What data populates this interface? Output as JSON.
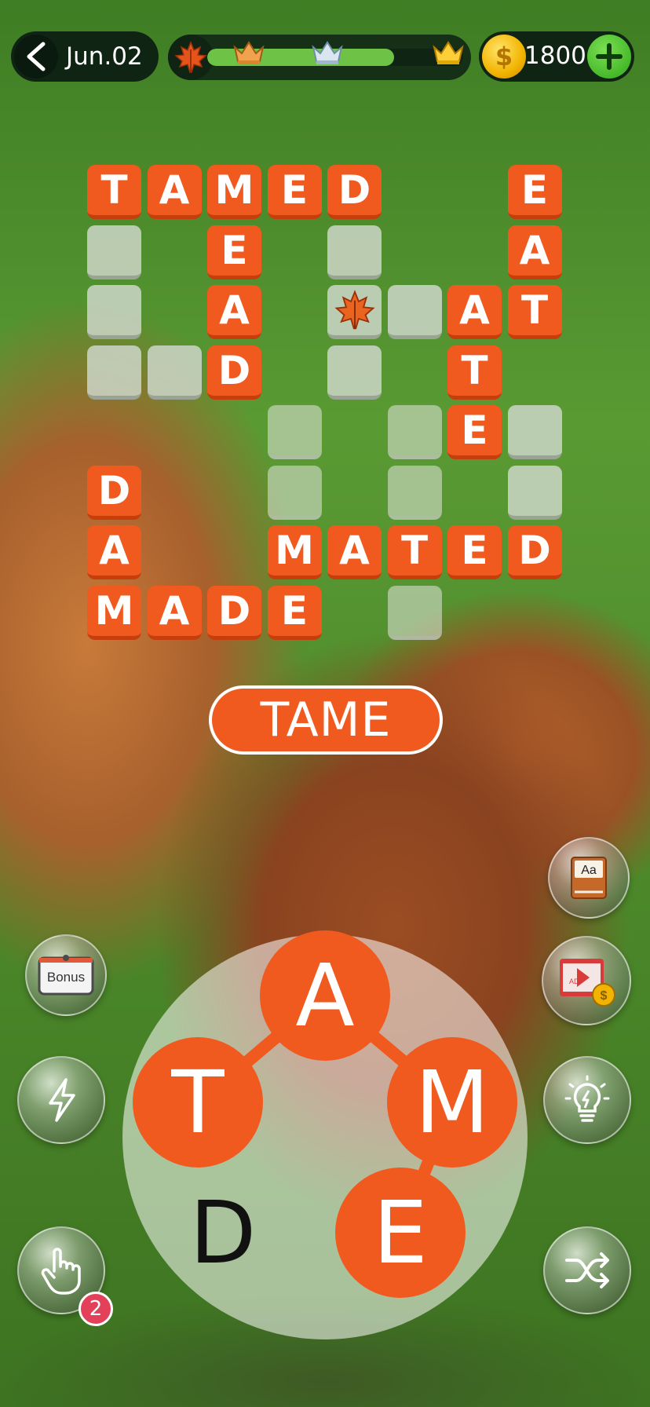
{
  "header": {
    "date": "Jun.02",
    "coins": "1800",
    "level_progress": 0.73
  },
  "grid": {
    "filled_cells": [
      {
        "col": 0,
        "row": 0,
        "letter": "T"
      },
      {
        "col": 1,
        "row": 0,
        "letter": "A"
      },
      {
        "col": 2,
        "row": 0,
        "letter": "M"
      },
      {
        "col": 3,
        "row": 0,
        "letter": "E"
      },
      {
        "col": 4,
        "row": 0,
        "letter": "D"
      },
      {
        "col": 7,
        "row": 0,
        "letter": "E"
      },
      {
        "col": 2,
        "row": 1,
        "letter": "E"
      },
      {
        "col": 7,
        "row": 1,
        "letter": "A"
      },
      {
        "col": 2,
        "row": 2,
        "letter": "A"
      },
      {
        "col": 6,
        "row": 2,
        "letter": "A"
      },
      {
        "col": 7,
        "row": 2,
        "letter": "T"
      },
      {
        "col": 2,
        "row": 3,
        "letter": "D"
      },
      {
        "col": 6,
        "row": 3,
        "letter": "T"
      },
      {
        "col": 6,
        "row": 4,
        "letter": "E"
      },
      {
        "col": 0,
        "row": 5,
        "letter": "D"
      },
      {
        "col": 0,
        "row": 6,
        "letter": "A"
      },
      {
        "col": 3,
        "row": 6,
        "letter": "M"
      },
      {
        "col": 4,
        "row": 6,
        "letter": "A"
      },
      {
        "col": 5,
        "row": 6,
        "letter": "T"
      },
      {
        "col": 6,
        "row": 6,
        "letter": "E"
      },
      {
        "col": 7,
        "row": 6,
        "letter": "D"
      },
      {
        "col": 0,
        "row": 7,
        "letter": "M"
      },
      {
        "col": 1,
        "row": 7,
        "letter": "A"
      },
      {
        "col": 2,
        "row": 7,
        "letter": "D"
      },
      {
        "col": 3,
        "row": 7,
        "letter": "E"
      }
    ],
    "empty_cells": [
      {
        "col": 0,
        "row": 1
      },
      {
        "col": 4,
        "row": 1
      },
      {
        "col": 0,
        "row": 2
      },
      {
        "col": 5,
        "row": 2
      },
      {
        "col": 0,
        "row": 3
      },
      {
        "col": 1,
        "row": 3
      },
      {
        "col": 4,
        "row": 3
      },
      {
        "col": 3,
        "row": 4
      },
      {
        "col": 5,
        "row": 4
      },
      {
        "col": 7,
        "row": 4
      },
      {
        "col": 3,
        "row": 5
      },
      {
        "col": 5,
        "row": 5
      },
      {
        "col": 7,
        "row": 5
      },
      {
        "col": 5,
        "row": 7
      }
    ],
    "bonus_leaf_cell": {
      "col": 4,
      "row": 2
    }
  },
  "current_word": "TAME",
  "wheel": {
    "letters": [
      {
        "letter": "A",
        "selected": true,
        "node": "a"
      },
      {
        "letter": "T",
        "selected": true,
        "node": "t"
      },
      {
        "letter": "M",
        "selected": true,
        "node": "m"
      },
      {
        "letter": "E",
        "selected": true,
        "node": "e"
      },
      {
        "letter": "D",
        "selected": false,
        "node": "d"
      }
    ]
  },
  "buttons": {
    "bonus_label": "Bonus",
    "dictionary_label": "Aa",
    "hand_badge": "2",
    "ad_label": "AD"
  },
  "colors": {
    "tile": "#f05a1f",
    "progress": "#6ec347",
    "coin": "#f2b400",
    "plus": "#2fa91a",
    "badge": "#e3405a"
  }
}
